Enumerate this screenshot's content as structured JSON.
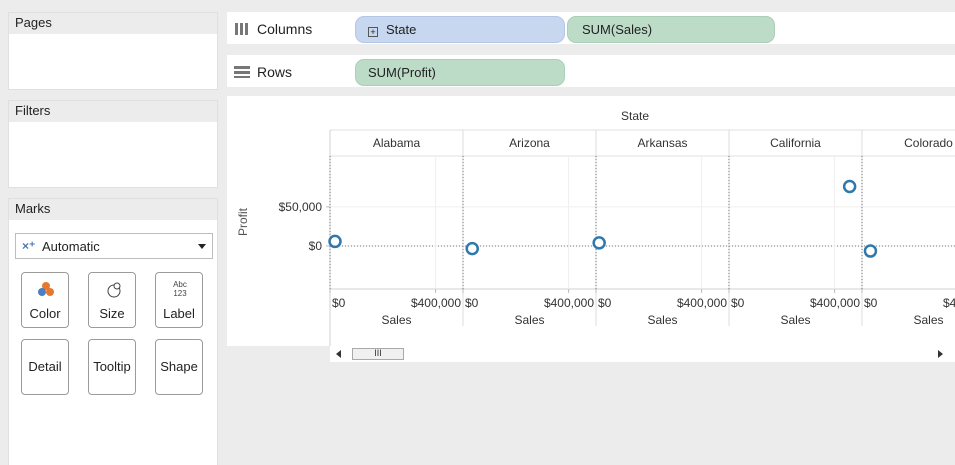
{
  "cards": {
    "pages_title": "Pages",
    "filters_title": "Filters",
    "marks_title": "Marks"
  },
  "marks": {
    "mark_type": "Automatic",
    "buttons": {
      "color": "Color",
      "size": "Size",
      "label": "Label",
      "detail": "Detail",
      "tooltip": "Tooltip",
      "shape": "Shape"
    },
    "label_icon_text": "Abc\n123"
  },
  "shelves": {
    "columns_label": "Columns",
    "rows_label": "Rows",
    "columns_pills": [
      "State",
      "SUM(Sales)"
    ],
    "rows_pills": [
      "SUM(Profit)"
    ]
  },
  "view": {
    "header_title": "State",
    "y_axis_title": "Profit",
    "x_axis_title": "Sales"
  },
  "scrollbar": {
    "thumb_grip": "III"
  },
  "colors": {
    "mark_stroke": "#2f78ad",
    "dimension_pill": "#c6d7ef",
    "measure_pill": "#bddcc7"
  },
  "chart_data": {
    "type": "scatter",
    "title": "",
    "panels": [
      "Alabama",
      "Arizona",
      "Arkansas",
      "California",
      "Colorado"
    ],
    "xlabel": "Sales",
    "ylabel": "Profit",
    "x_ticks": [
      "$0",
      "$400,000"
    ],
    "y_ticks": [
      "$50,000",
      "$0"
    ],
    "ylim": [
      -55000,
      115000
    ],
    "xlim": [
      0,
      500000
    ],
    "points": [
      {
        "panel": "Alabama",
        "x": 19000,
        "y": 5800
      },
      {
        "panel": "Arizona",
        "x": 35000,
        "y": -3400
      },
      {
        "panel": "Arkansas",
        "x": 12000,
        "y": 4000
      },
      {
        "panel": "California",
        "x": 457000,
        "y": 76000
      },
      {
        "panel": "Colorado",
        "x": 32000,
        "y": -6500
      }
    ]
  }
}
